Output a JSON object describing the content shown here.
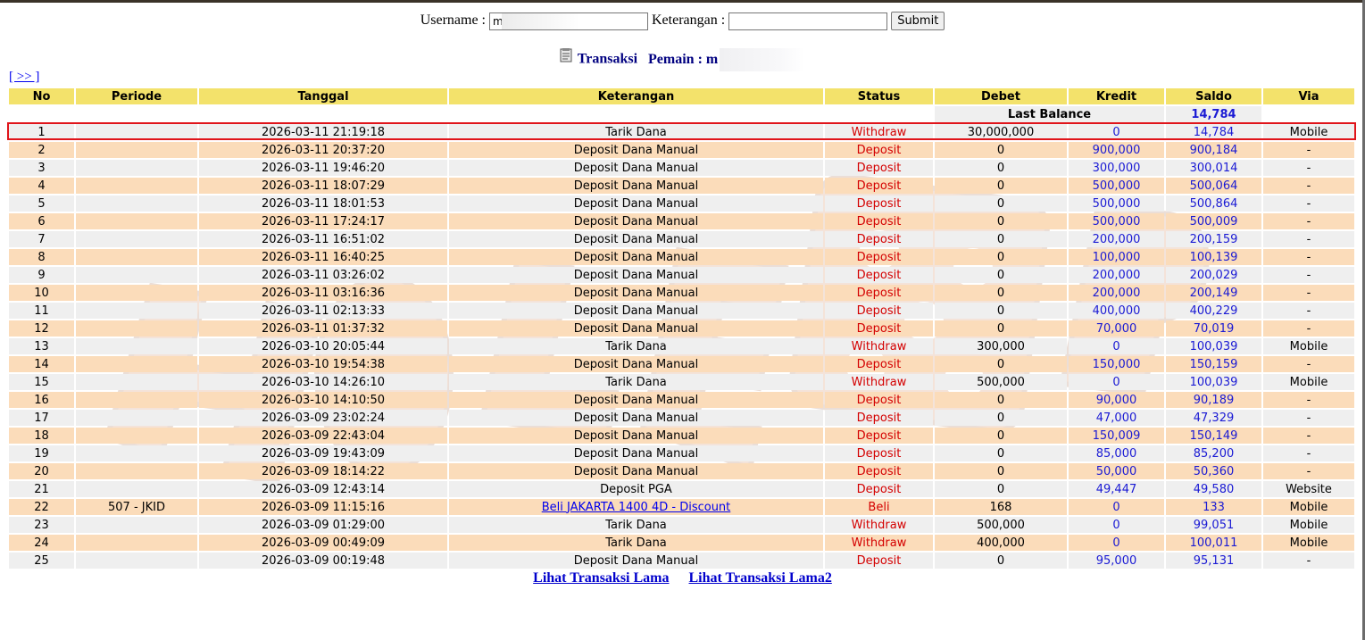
{
  "form": {
    "username_label": "Username :",
    "username_value": "m",
    "keterangan_label": "Keterangan :",
    "keterangan_value": "",
    "submit_label": "Submit"
  },
  "title": {
    "transaksi": "Transaksi",
    "pemain": "Pemain : m"
  },
  "nav": {
    "next_label": "[ >> ]"
  },
  "table": {
    "headers": [
      "No",
      "Periode",
      "Tanggal",
      "Keterangan",
      "Status",
      "Debet",
      "Kredit",
      "Saldo",
      "Via"
    ],
    "last_balance_label": "Last Balance",
    "last_balance_value": "14,784",
    "rows": [
      {
        "no": "1",
        "periode": "",
        "tanggal": "2026-03-11 21:19:18",
        "keterangan": "Tarik Dana",
        "status": "Withdraw",
        "debet": "30,000,000",
        "kredit": "0",
        "saldo": "14,784",
        "via": "Mobile"
      },
      {
        "no": "2",
        "periode": "",
        "tanggal": "2026-03-11 20:37:20",
        "keterangan": "Deposit Dana Manual",
        "status": "Deposit",
        "debet": "0",
        "kredit": "900,000",
        "saldo": "900,184",
        "via": "-"
      },
      {
        "no": "3",
        "periode": "",
        "tanggal": "2026-03-11 19:46:20",
        "keterangan": "Deposit Dana Manual",
        "status": "Deposit",
        "debet": "0",
        "kredit": "300,000",
        "saldo": "300,014",
        "via": "-"
      },
      {
        "no": "4",
        "periode": "",
        "tanggal": "2026-03-11 18:07:29",
        "keterangan": "Deposit Dana Manual",
        "status": "Deposit",
        "debet": "0",
        "kredit": "500,000",
        "saldo": "500,064",
        "via": "-"
      },
      {
        "no": "5",
        "periode": "",
        "tanggal": "2026-03-11 18:01:53",
        "keterangan": "Deposit Dana Manual",
        "status": "Deposit",
        "debet": "0",
        "kredit": "500,000",
        "saldo": "500,864",
        "via": "-"
      },
      {
        "no": "6",
        "periode": "",
        "tanggal": "2026-03-11 17:24:17",
        "keterangan": "Deposit Dana Manual",
        "status": "Deposit",
        "debet": "0",
        "kredit": "500,000",
        "saldo": "500,009",
        "via": "-"
      },
      {
        "no": "7",
        "periode": "",
        "tanggal": "2026-03-11 16:51:02",
        "keterangan": "Deposit Dana Manual",
        "status": "Deposit",
        "debet": "0",
        "kredit": "200,000",
        "saldo": "200,159",
        "via": "-"
      },
      {
        "no": "8",
        "periode": "",
        "tanggal": "2026-03-11 16:40:25",
        "keterangan": "Deposit Dana Manual",
        "status": "Deposit",
        "debet": "0",
        "kredit": "100,000",
        "saldo": "100,139",
        "via": "-"
      },
      {
        "no": "9",
        "periode": "",
        "tanggal": "2026-03-11 03:26:02",
        "keterangan": "Deposit Dana Manual",
        "status": "Deposit",
        "debet": "0",
        "kredit": "200,000",
        "saldo": "200,029",
        "via": "-"
      },
      {
        "no": "10",
        "periode": "",
        "tanggal": "2026-03-11 03:16:36",
        "keterangan": "Deposit Dana Manual",
        "status": "Deposit",
        "debet": "0",
        "kredit": "200,000",
        "saldo": "200,149",
        "via": "-"
      },
      {
        "no": "11",
        "periode": "",
        "tanggal": "2026-03-11 02:13:33",
        "keterangan": "Deposit Dana Manual",
        "status": "Deposit",
        "debet": "0",
        "kredit": "400,000",
        "saldo": "400,229",
        "via": "-"
      },
      {
        "no": "12",
        "periode": "",
        "tanggal": "2026-03-11 01:37:32",
        "keterangan": "Deposit Dana Manual",
        "status": "Deposit",
        "debet": "0",
        "kredit": "70,000",
        "saldo": "70,019",
        "via": "-"
      },
      {
        "no": "13",
        "periode": "",
        "tanggal": "2026-03-10 20:05:44",
        "keterangan": "Tarik Dana",
        "status": "Withdraw",
        "debet": "300,000",
        "kredit": "0",
        "saldo": "100,039",
        "via": "Mobile"
      },
      {
        "no": "14",
        "periode": "",
        "tanggal": "2026-03-10 19:54:38",
        "keterangan": "Deposit Dana Manual",
        "status": "Deposit",
        "debet": "0",
        "kredit": "150,000",
        "saldo": "150,159",
        "via": "-"
      },
      {
        "no": "15",
        "periode": "",
        "tanggal": "2026-03-10 14:26:10",
        "keterangan": "Tarik Dana",
        "status": "Withdraw",
        "debet": "500,000",
        "kredit": "0",
        "saldo": "100,039",
        "via": "Mobile"
      },
      {
        "no": "16",
        "periode": "",
        "tanggal": "2026-03-10 14:10:50",
        "keterangan": "Deposit Dana Manual",
        "status": "Deposit",
        "debet": "0",
        "kredit": "90,000",
        "saldo": "90,189",
        "via": "-"
      },
      {
        "no": "17",
        "periode": "",
        "tanggal": "2026-03-09 23:02:24",
        "keterangan": "Deposit Dana Manual",
        "status": "Deposit",
        "debet": "0",
        "kredit": "47,000",
        "saldo": "47,329",
        "via": "-"
      },
      {
        "no": "18",
        "periode": "",
        "tanggal": "2026-03-09 22:43:04",
        "keterangan": "Deposit Dana Manual",
        "status": "Deposit",
        "debet": "0",
        "kredit": "150,009",
        "saldo": "150,149",
        "via": "-"
      },
      {
        "no": "19",
        "periode": "",
        "tanggal": "2026-03-09 19:43:09",
        "keterangan": "Deposit Dana Manual",
        "status": "Deposit",
        "debet": "0",
        "kredit": "85,000",
        "saldo": "85,200",
        "via": "-"
      },
      {
        "no": "20",
        "periode": "",
        "tanggal": "2026-03-09 18:14:22",
        "keterangan": "Deposit Dana Manual",
        "status": "Deposit",
        "debet": "0",
        "kredit": "50,000",
        "saldo": "50,360",
        "via": "-"
      },
      {
        "no": "21",
        "periode": "",
        "tanggal": "2026-03-09 12:43:14",
        "keterangan": "Deposit PGA",
        "status": "Deposit",
        "debet": "0",
        "kredit": "49,447",
        "saldo": "49,580",
        "via": "Website"
      },
      {
        "no": "22",
        "periode": "507 - JKID",
        "tanggal": "2026-03-09 11:15:16",
        "keterangan": "Beli JAKARTA 1400 4D - Discount",
        "status": "Beli",
        "debet": "168",
        "kredit": "0",
        "saldo": "133",
        "via": "Mobile",
        "link": true
      },
      {
        "no": "23",
        "periode": "",
        "tanggal": "2026-03-09 01:29:00",
        "keterangan": "Tarik Dana",
        "status": "Withdraw",
        "debet": "500,000",
        "kredit": "0",
        "saldo": "99,051",
        "via": "Mobile"
      },
      {
        "no": "24",
        "periode": "",
        "tanggal": "2026-03-09 00:49:09",
        "keterangan": "Tarik Dana",
        "status": "Withdraw",
        "debet": "400,000",
        "kredit": "0",
        "saldo": "100,011",
        "via": "Mobile"
      },
      {
        "no": "25",
        "periode": "",
        "tanggal": "2026-03-09 00:19:48",
        "keterangan": "Deposit Dana Manual",
        "status": "Deposit",
        "debet": "0",
        "kredit": "95,000",
        "saldo": "95,131",
        "via": "-"
      }
    ]
  },
  "footer": {
    "link1": "Lihat Transaksi Lama",
    "link2": "Lihat Transaksi Lama2"
  },
  "colors": {
    "header_bg": "#f3e26b",
    "row_odd": "#efefef",
    "row_even": "#fbdcba",
    "status": "#d40000",
    "amount_blue": "#1a1ad4",
    "highlight": "#e0141a"
  }
}
